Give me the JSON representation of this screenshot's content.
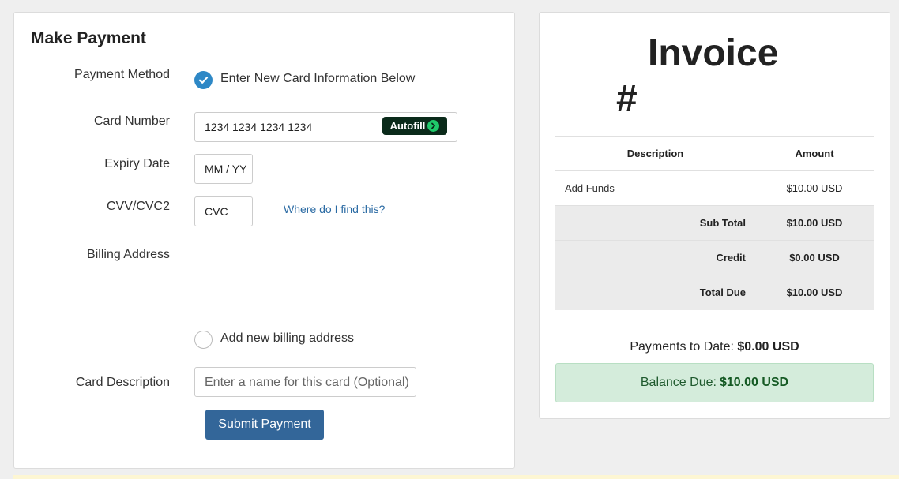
{
  "payment": {
    "title": "Make Payment",
    "labels": {
      "method": "Payment Method",
      "card_number": "Card Number",
      "expiry": "Expiry Date",
      "cvv": "CVV/CVC2",
      "billing": "Billing Address",
      "description": "Card Description"
    },
    "method_option": "Enter New Card Information Below",
    "card_number_value": "1234 1234 1234 1234",
    "autofill_label": "Autofill",
    "expiry_value": "MM / YY",
    "cvc_value": "CVC",
    "find_link": "Where do I find this?",
    "billing_option": "Add new billing address",
    "description_placeholder": "Enter a name for this card (Optional)",
    "submit_label": "Submit Payment"
  },
  "invoice": {
    "title": "Invoice",
    "hash": "#",
    "columns": [
      "Description",
      "Amount"
    ],
    "items": [
      {
        "description": "Add Funds",
        "amount": "$10.00 USD"
      }
    ],
    "sub_total_label": "Sub Total",
    "sub_total": "$10.00 USD",
    "credit_label": "Credit",
    "credit": "$0.00 USD",
    "total_due_label": "Total Due",
    "total_due": "$10.00 USD",
    "payments_to_date_label": "Payments to Date:",
    "payments_to_date": "$0.00 USD",
    "balance_due_label": "Balance Due:",
    "balance_due": "$10.00 USD"
  },
  "colors": {
    "accent": "#2e88c6",
    "button": "#336699",
    "balance_bg": "#d4ecdb"
  }
}
